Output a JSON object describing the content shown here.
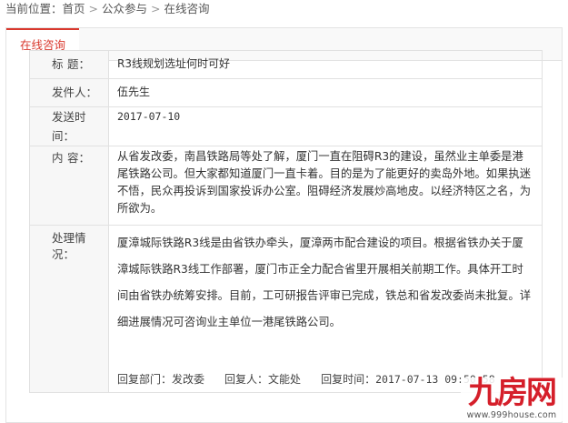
{
  "breadcrumb": {
    "prefix": "当前位置：",
    "items": [
      "首页",
      "公众参与",
      "在线咨询"
    ],
    "separator": ">"
  },
  "tabs": [
    {
      "label": "在线咨询",
      "active": true
    }
  ],
  "accent_color": "#d9382d",
  "detail": {
    "title_label_chars": [
      "标",
      "题："
    ],
    "title_value": "R3线规划选址何时可好",
    "sender_label_chars": [
      "发",
      "件",
      "人："
    ],
    "sender_value": "伍先生",
    "time_label": "发送时间：",
    "time_value": "2017-07-10",
    "content_label_chars": [
      "内",
      "容："
    ],
    "content_value": "从省发改委，南昌铁路局等处了解，厦门一直在阻碍R3的建设，虽然业主单委是港尾铁路公司。但大家都知道厦门一直卡着。目的是为了能更好的卖岛外地。如果执迷不悟，民众再投诉到国家投诉办公室。阻碍经济发展炒高地皮。以经济特区之名，为所欲为。",
    "reply_label": "处理情况：",
    "reply_value": "厦漳城际铁路R3线是由省铁办牵头，厦漳两市配合建设的项目。根据省铁办关于厦漳城际铁路R3线工作部署，厦门市正全力配合省里开展相关前期工作。具体开工时间由省铁办统筹安排。目前，工可研报告评审已完成，铁总和省发改委尚未批复。详细进展情况可咨询业主单位一港尾铁路公司。",
    "reply_dept_label": "回复部门：",
    "reply_dept": "发改委",
    "reply_person_label": "回复人：",
    "reply_person": "文能处",
    "reply_time_label": "回复时间：",
    "reply_time": "2017-07-13 09:50:58"
  },
  "watermark": {
    "logo": "九房网",
    "url": "www.999house.com"
  }
}
